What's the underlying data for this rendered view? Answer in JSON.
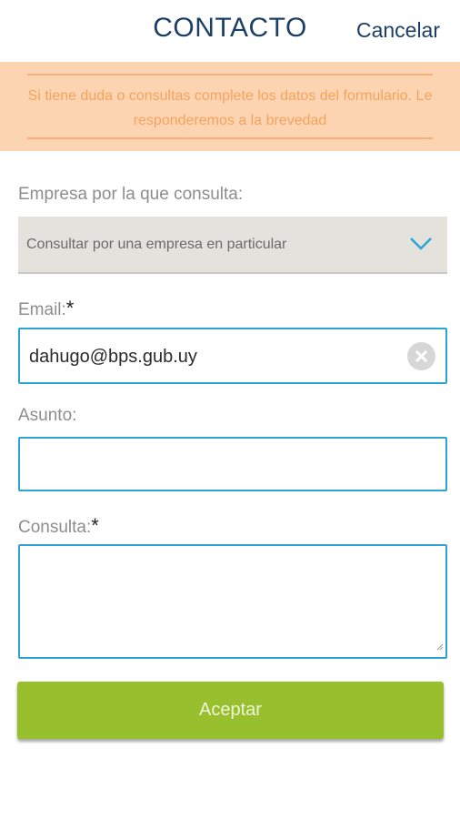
{
  "header": {
    "title": "CONTACTO",
    "cancel_label": "Cancelar"
  },
  "notice": {
    "text": "Si tiene duda o consultas complete los datos del formulario. Le responderemos a la brevedad"
  },
  "form": {
    "empresa": {
      "label": "Empresa por la que consulta:",
      "selected": "Consultar por una empresa en particular"
    },
    "email": {
      "label": "Email:",
      "required_mark": "*",
      "value": "dahugo@bps.gub.uy"
    },
    "asunto": {
      "label": "Asunto:",
      "value": ""
    },
    "consulta": {
      "label": "Consulta:",
      "required_mark": "*",
      "value": ""
    },
    "submit_label": "Aceptar"
  },
  "colors": {
    "title": "#1d3f66",
    "notice_bg": "#fdd4b2",
    "notice_text": "#f5a35c",
    "input_border": "#2ea3d6",
    "button": "#98bf2e",
    "chevron": "#2ea3d6"
  },
  "icons": {
    "select_arrow": "chevron-down-icon",
    "clear": "clear-circle-icon",
    "resize": "resize-grip-icon"
  }
}
